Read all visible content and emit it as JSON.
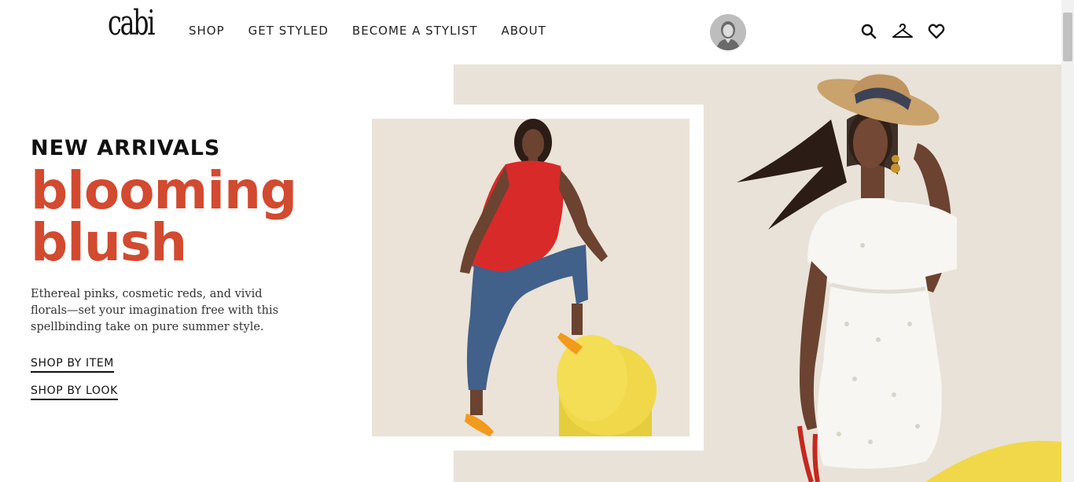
{
  "header": {
    "logo": "cabi",
    "nav": [
      "SHOP",
      "GET STYLED",
      "BECOME A STYLIST",
      "ABOUT"
    ],
    "icons": [
      "search-icon",
      "hanger-icon",
      "heart-icon"
    ]
  },
  "hero": {
    "eyebrow": "NEW ARRIVALS",
    "title_line1": "blooming",
    "title_line2": "blush",
    "description": "Ethereal pinks, cosmetic reds, and vivid florals—set your imagination free with this spellbinding take on pure summer style.",
    "cta_item": "SHOP BY ITEM",
    "cta_look": "SHOP BY LOOK"
  },
  "colors": {
    "accent": "#d24a2f",
    "background_beige": "#e9e2d8",
    "yellow_prop": "#f0d84a",
    "red_top": "#d92a2a"
  }
}
